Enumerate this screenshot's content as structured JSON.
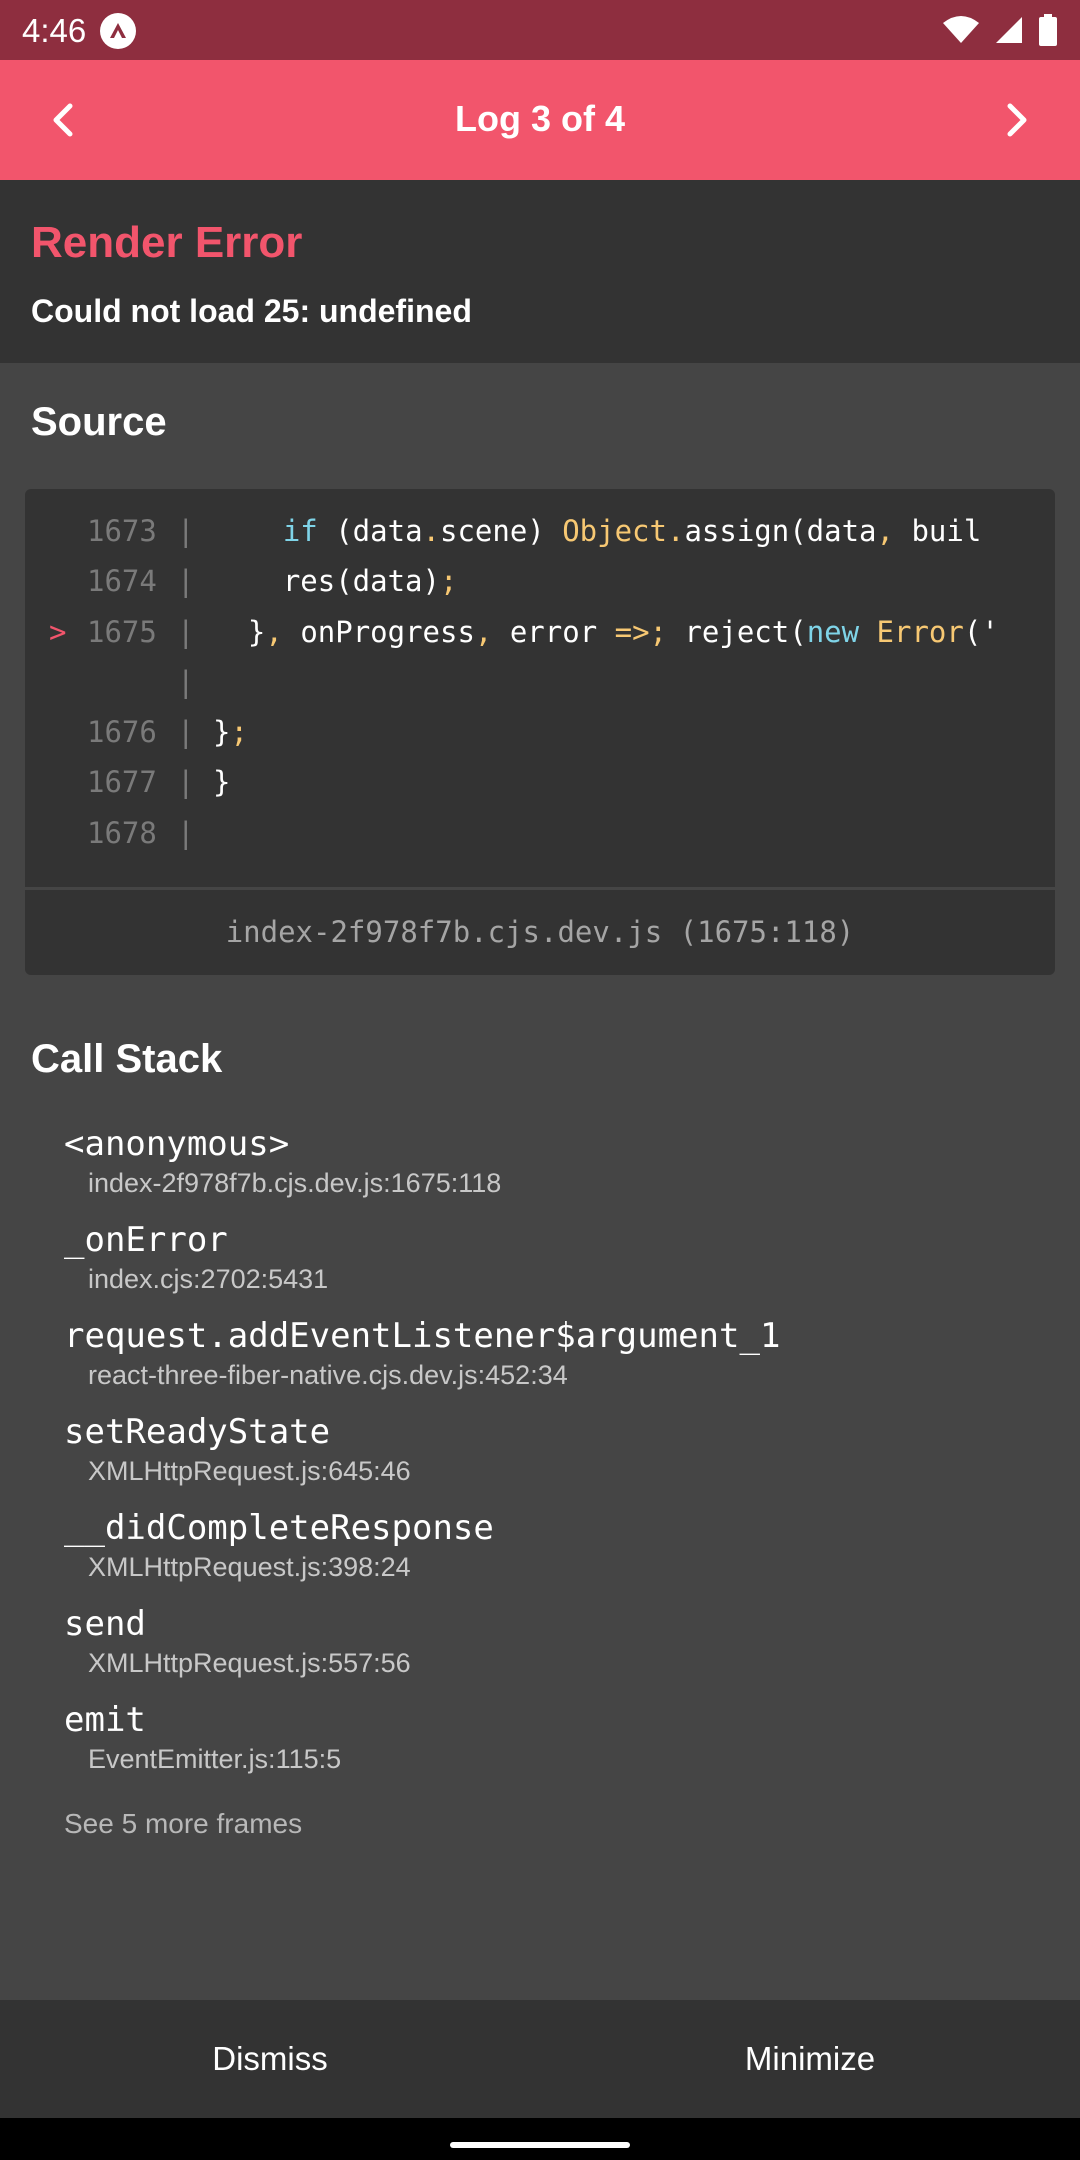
{
  "status_bar": {
    "time": "4:46",
    "icons": [
      "app-notification-icon",
      "wifi-icon",
      "signal-icon",
      "battery-icon"
    ]
  },
  "header": {
    "title": "Log 3 of 4",
    "prev_icon": "chevron-left-icon",
    "next_icon": "chevron-right-icon",
    "color": "#f2556c"
  },
  "error": {
    "title": "Render Error",
    "message": "Could not load 25: undefined",
    "title_color": "#f2556c"
  },
  "source": {
    "section_title": "Source",
    "lines": [
      {
        "marker": "",
        "number": "1673",
        "code": "    if (data.scene) Object.assign(data, buil"
      },
      {
        "marker": "",
        "number": "1674",
        "code": "    res(data);"
      },
      {
        "marker": ">",
        "number": "1675",
        "code": "  }, onProgress, error => reject(new Error('"
      },
      {
        "marker": "",
        "number": "",
        "code": ""
      },
      {
        "marker": "",
        "number": "1676",
        "code": "};"
      },
      {
        "marker": "",
        "number": "1677",
        "code": "}"
      },
      {
        "marker": "",
        "number": "1678",
        "code": ""
      }
    ],
    "file_location": "index-2f978f7b.cjs.dev.js (1675:118)"
  },
  "call_stack": {
    "section_title": "Call Stack",
    "frames": [
      {
        "function": "<anonymous>",
        "location": "index-2f978f7b.cjs.dev.js:1675:118"
      },
      {
        "function": "_onError",
        "location": "index.cjs:2702:5431"
      },
      {
        "function": "request.addEventListener$argument_1",
        "location": "react-three-fiber-native.cjs.dev.js:452:34"
      },
      {
        "function": "setReadyState",
        "location": "XMLHttpRequest.js:645:46"
      },
      {
        "function": "__didCompleteResponse",
        "location": "XMLHttpRequest.js:398:24"
      },
      {
        "function": "send",
        "location": "XMLHttpRequest.js:557:56"
      },
      {
        "function": "emit",
        "location": "EventEmitter.js:115:5"
      }
    ],
    "more_frames": "See 5 more frames"
  },
  "footer": {
    "dismiss_label": "Dismiss",
    "minimize_label": "Minimize"
  }
}
